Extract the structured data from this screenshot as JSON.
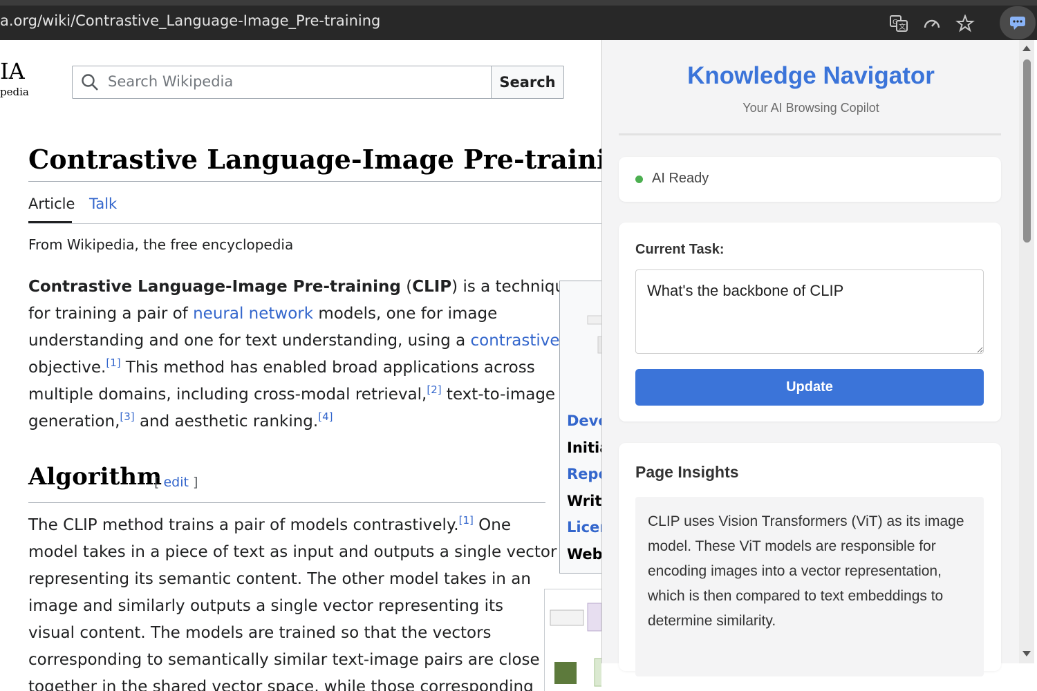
{
  "browser": {
    "url": "a.org/wiki/Contrastive_Language-Image_Pre-training"
  },
  "wiki": {
    "logo_big": "IA",
    "logo_small": "pedia",
    "search_placeholder": "Search Wikipedia",
    "search_button": "Search",
    "title": "Contrastive Language-Image Pre-training",
    "tabs": [
      "Article",
      "Talk"
    ],
    "tagline": "From Wikipedia, the free encyclopedia",
    "intro": {
      "bold_term": "Contrastive Language-Image Pre-training",
      "p1": " (",
      "abbr": "CLIP",
      "p2": ") is a technique",
      "p3": "for training a pair of ",
      "link_neural": "neural network",
      "p4": " models, one for image",
      "p5": "understanding and one for text understanding, using a ",
      "link_contrastive": "contrastive",
      "p6": "objective.",
      "ref1": "[1]",
      "p7": " This method has enabled broad applications across",
      "p8": "multiple domains, including cross-modal retrieval,",
      "ref2": "[2]",
      "p9": " text-to-image",
      "p10": "generation,",
      "ref3": "[3]",
      "p11": " and aesthetic ranking.",
      "ref4": "[4]"
    },
    "section_heading": "Algorithm",
    "edit_open": "[ ",
    "edit_label": "edit",
    "edit_close": " ]",
    "algorithm": {
      "l1": "The CLIP method trains a pair of models contrastively.",
      "ref1": "[1]",
      "l1b": " One",
      "l2": "model takes in a piece of text as input and outputs a single vector",
      "l3": "representing its semantic content. The other model takes in an",
      "l4": "image and similarly outputs a single vector representing its",
      "l5": "visual content. The models are trained so that the vectors",
      "l6": "corresponding to semantically similar text-image pairs are close",
      "l7": "together in the shared vector space, while those corresponding"
    },
    "infobox_rows": [
      "Deve",
      "Initia",
      "Repo",
      "Writt",
      "Licer",
      "Webs"
    ]
  },
  "extension": {
    "title": "Knowledge Navigator",
    "subtitle": "Your AI Browsing Copilot",
    "status": "AI Ready",
    "task_label": "Current Task:",
    "task_value": "What's the backbone of CLIP",
    "update_button": "Update",
    "insights_label": "Page Insights",
    "insights_lines": [
      "CLIP uses Vision Transformers (ViT) as its image",
      "model. These ViT models are responsible for",
      "encoding images into a vector representation,",
      "which is then compared to text embeddings to",
      "determine similarity."
    ]
  },
  "colors": {
    "accent": "#3b74d9",
    "status_ok": "#4caf50",
    "wiki_link": "#3366cc"
  },
  "icons": [
    "translate-icon",
    "performance-icon",
    "bookmark-star-icon",
    "extension-chat-icon",
    "search-icon"
  ]
}
